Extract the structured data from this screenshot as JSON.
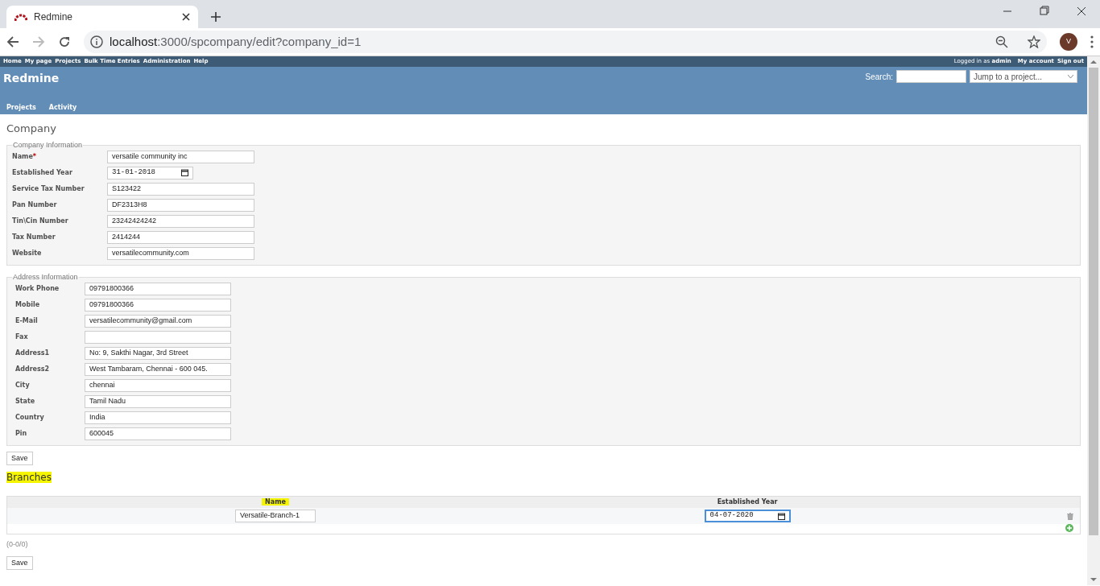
{
  "browser": {
    "tab_title": "Redmine",
    "url_host": "localhost",
    "url_rest": ":3000/spcompany/edit?company_id=1",
    "profile_initial": "V"
  },
  "top_menu": [
    "Home",
    "My page",
    "Projects",
    "Bulk Time Entries",
    "Administration",
    "Help"
  ],
  "account": {
    "logged_in": "Logged in as **admin**",
    "links": [
      "My account",
      "Sign out"
    ]
  },
  "header": {
    "title": "Redmine",
    "search_label": "Search:",
    "project_jump": "Jump to a project..."
  },
  "main_menu": [
    "Projects",
    "Activity"
  ],
  "page_title": "Company",
  "sections": [
    {
      "legend": "Company Information",
      "fields": [
        {
          "label": "Name",
          "required_mark": "*",
          "kind": "text",
          "value": "versatile community inc"
        },
        {
          "label": "Established Year",
          "kind": "date",
          "value": "31-01-2018"
        },
        {
          "label": "Service Tax Number",
          "kind": "text",
          "value": "S123422"
        },
        {
          "label": "Pan Number",
          "kind": "text",
          "value": "DF2313H8"
        },
        {
          "label": "Tin\\Cin Number",
          "kind": "text",
          "value": "23242424242"
        },
        {
          "label": "Tax Number",
          "kind": "text",
          "value": "2414244"
        },
        {
          "label": "Website",
          "kind": "text",
          "value": "versatilecommunity.com"
        }
      ]
    },
    {
      "legend": "Address Information",
      "fields": [
        {
          "label": "Work Phone",
          "kind": "text",
          "value": "09791800366"
        },
        {
          "label": "Mobile",
          "kind": "text",
          "value": "09791800366"
        },
        {
          "label": "E-Mail",
          "kind": "text",
          "value": "versatilecommunity@gmail.com"
        },
        {
          "label": "Fax",
          "kind": "text"
        },
        {
          "label": "Address1",
          "kind": "text",
          "value": "No: 9, Sakthi Nagar, 3rd Street"
        },
        {
          "label": "Address2",
          "kind": "text",
          "value": "West Tambaram, Chennai - 600 045."
        },
        {
          "label": "City",
          "kind": "text",
          "value": "chennai"
        },
        {
          "label": "State",
          "kind": "text",
          "value": "Tamil Nadu"
        },
        {
          "label": "Country",
          "kind": "text",
          "value": "India"
        },
        {
          "label": "Pin",
          "kind": "text",
          "value": "600045"
        }
      ]
    }
  ],
  "save_label": "Save",
  "branches": {
    "title": "Branches",
    "highlighted": true,
    "columns": [
      {
        "label": "Name",
        "highlighted": true
      },
      {
        "label": "Established Year",
        "highlighted": false
      }
    ],
    "rows": [
      {
        "name": "Versatile-Branch-1",
        "established_year": "04-07-2020",
        "focused": true
      }
    ],
    "pagination": "(0-0/0)",
    "save_label": "Save"
  }
}
